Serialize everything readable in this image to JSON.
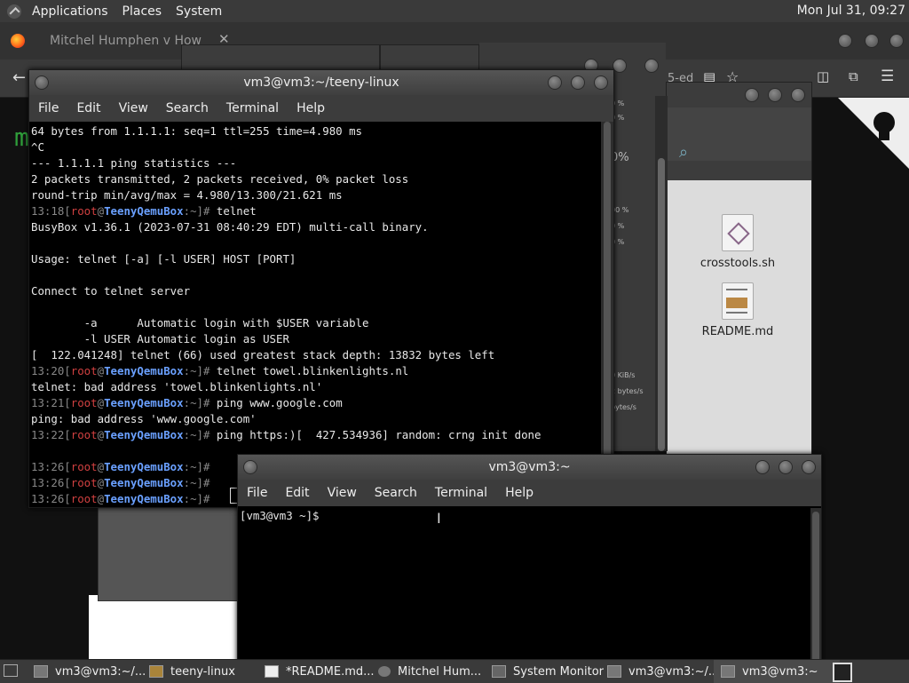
{
  "top_panel": {
    "menus": [
      "Applications",
      "Places",
      "System"
    ],
    "clock": "Mon Jul 31, 09:27"
  },
  "browser": {
    "tab_title": "Mitchel Humphen v How",
    "url_fragment": "5-ed",
    "content_text": "m"
  },
  "file_manager": {
    "files": [
      {
        "name": "crosstools.sh"
      },
      {
        "name": "README.md"
      }
    ]
  },
  "system_monitor": {
    "readings": [
      "0 %",
      "0 %",
      "0%",
      "00 %",
      "0 %",
      "0 %",
      "0 KiB/s",
      "2 bytes/s",
      "bytes/s"
    ]
  },
  "terminal1": {
    "title": "vm3@vm3:~/teeny-linux",
    "menu": [
      "File",
      "Edit",
      "View",
      "Search",
      "Terminal",
      "Help"
    ],
    "lines": [
      {
        "text": "64 bytes from 1.1.1.1: seq=1 ttl=255 time=4.980 ms"
      },
      {
        "text": "^C"
      },
      {
        "text": "--- 1.1.1.1 ping statistics ---"
      },
      {
        "text": "2 packets transmitted, 2 packets received, 0% packet loss"
      },
      {
        "text": "round-trip min/avg/max = 4.980/13.300/21.621 ms"
      },
      {
        "time": "13:18",
        "cmd": "telnet"
      },
      {
        "text": "BusyBox v1.36.1 (2023-07-31 08:40:29 EDT) multi-call binary."
      },
      {
        "text": ""
      },
      {
        "text": "Usage: telnet [-a] [-l USER] HOST [PORT]"
      },
      {
        "text": ""
      },
      {
        "text": "Connect to telnet server"
      },
      {
        "text": ""
      },
      {
        "text": "        -a      Automatic login with $USER variable"
      },
      {
        "text": "        -l USER Automatic login as USER"
      },
      {
        "text": "[  122.041248] telnet (66) used greatest stack depth: 13832 bytes left"
      },
      {
        "time": "13:20",
        "cmd": "telnet towel.blinkenlights.nl"
      },
      {
        "text": "telnet: bad address 'towel.blinkenlights.nl'"
      },
      {
        "time": "13:21",
        "cmd": "ping www.google.com"
      },
      {
        "text": "ping: bad address 'www.google.com'"
      },
      {
        "time": "13:22",
        "cmd": "ping https:)[  427.534936] random: crng init done"
      },
      {
        "text": ""
      },
      {
        "time": "13:26",
        "cmd": ""
      },
      {
        "time": "13:26",
        "cmd": ""
      },
      {
        "time": "13:26",
        "cmd": ""
      }
    ],
    "prompt_user": "root",
    "prompt_host": "TeenyQemuBox",
    "prompt_path": ":~]# "
  },
  "terminal2": {
    "title": "vm3@vm3:~",
    "menu": [
      "File",
      "Edit",
      "View",
      "Search",
      "Terminal",
      "Help"
    ],
    "prompt": "[vm3@vm3 ~]$"
  },
  "taskbar": {
    "items": [
      {
        "label": "vm3@vm3:~/..."
      },
      {
        "label": "teeny-linux"
      },
      {
        "label": "*README.md..."
      },
      {
        "label": "Mitchel Hum..."
      },
      {
        "label": "System Monitor"
      },
      {
        "label": "vm3@vm3:~/..."
      },
      {
        "label": "vm3@vm3:~"
      }
    ]
  }
}
